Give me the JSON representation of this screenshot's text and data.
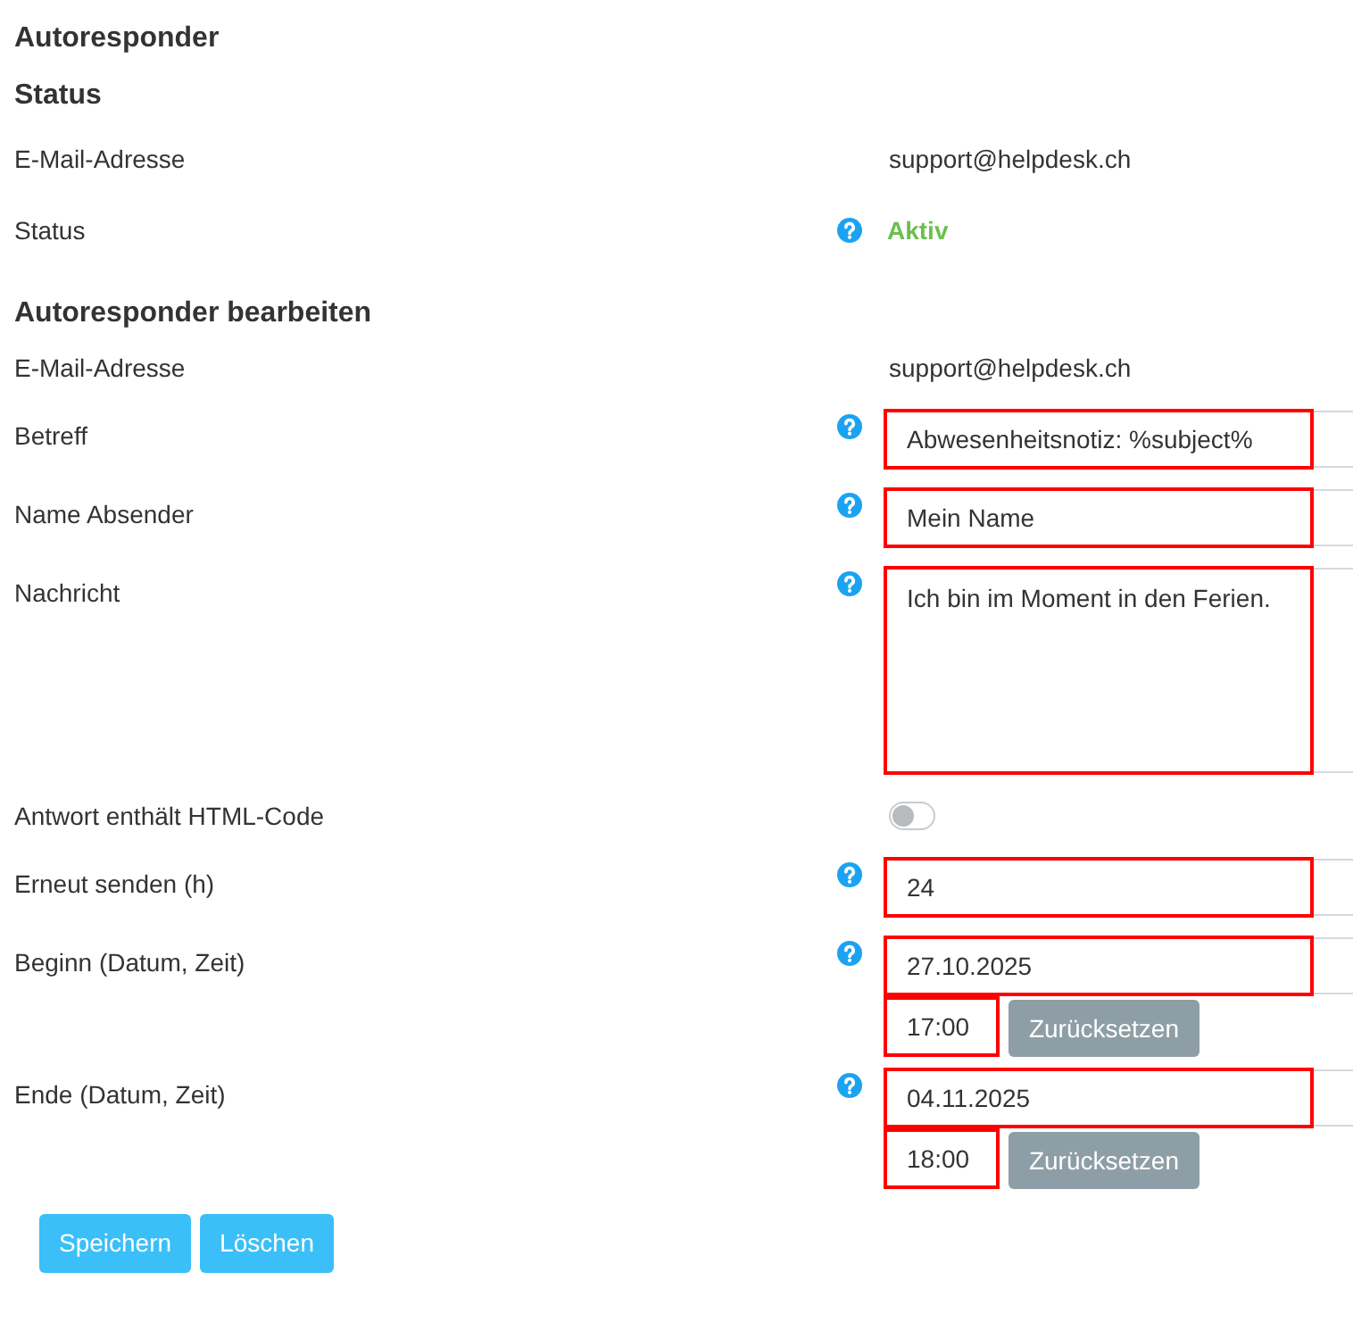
{
  "title": "Autoresponder",
  "sections": [
    {
      "heading": "Status",
      "rows": [
        {
          "kind": "text",
          "label": "E-Mail-Adresse",
          "help": false,
          "value": "support@helpdesk.ch"
        },
        {
          "kind": "status",
          "label": "Status",
          "help": true,
          "value": "Aktiv",
          "active": true
        }
      ]
    },
    {
      "heading": "Autoresponder bearbeiten",
      "rows": [
        {
          "kind": "text",
          "label": "E-Mail-Adresse",
          "help": false,
          "value": "support@helpdesk.ch"
        },
        {
          "kind": "input",
          "label": "Betreff",
          "help": true,
          "value": "Abwesenheitsnotiz: %subject%",
          "highlighted": true
        },
        {
          "kind": "input",
          "label": "Name Absender",
          "help": true,
          "value": "Mein Name",
          "highlighted": true
        },
        {
          "kind": "textarea",
          "label": "Nachricht",
          "help": true,
          "value": "Ich bin im Moment in den Ferien.",
          "highlighted": true
        },
        {
          "kind": "toggle",
          "label": "Antwort enthält HTML-Code",
          "help": false,
          "on": false
        },
        {
          "kind": "input",
          "label": "Erneut senden (h)",
          "help": true,
          "value": "24",
          "highlighted": true
        },
        {
          "kind": "datetime",
          "label": "Beginn (Datum, Zeit)",
          "help": true,
          "date": {
            "value": "27.10.2025",
            "highlighted": true
          },
          "time": {
            "value": "17:00",
            "highlighted": true
          },
          "reset_button": "Zurücksetzen"
        },
        {
          "kind": "datetime",
          "label": "Ende (Datum, Zeit)",
          "help": true,
          "date": {
            "value": "04.11.2025",
            "highlighted": true
          },
          "time": {
            "value": "18:00",
            "highlighted": true
          },
          "reset_button": "Zurücksetzen"
        }
      ]
    }
  ],
  "buttons": [
    "Speichern",
    "Löschen"
  ]
}
